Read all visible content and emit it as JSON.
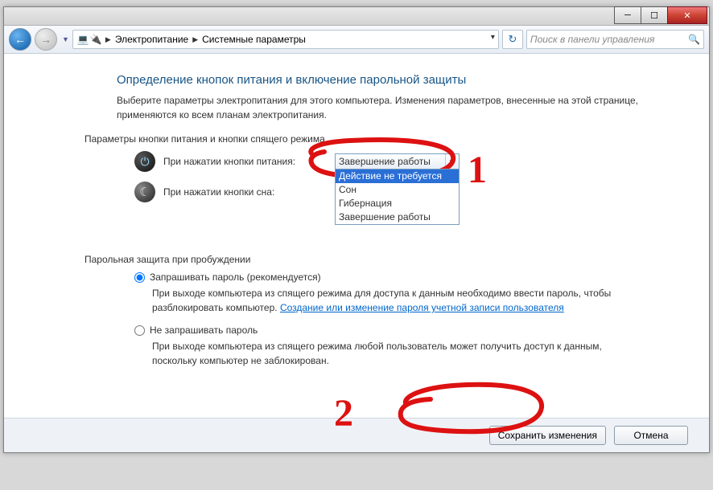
{
  "breadcrumb": {
    "icon1": "💻",
    "icon2": "🔌",
    "seg1": "Электропитание",
    "seg2": "Системные параметры"
  },
  "search": {
    "placeholder": "Поиск в панели управления"
  },
  "heading": "Определение кнопок питания и включение парольной защиты",
  "intro": "Выберите параметры электропитания для этого компьютера. Изменения параметров, внесенные на этой странице, применяются ко всем планам электропитания.",
  "section_buttons": "Параметры кнопки питания и кнопки спящего режима",
  "power": {
    "label": "При нажатии кнопки питания:",
    "selected": "Завершение работы",
    "options": [
      "Действие не требуется",
      "Сон",
      "Гибернация",
      "Завершение работы"
    ]
  },
  "sleep": {
    "label": "При нажатии кнопки сна:"
  },
  "section_password": "Парольная защита при пробуждении",
  "radio1": {
    "label": "Запрашивать пароль (рекомендуется)",
    "desc_a": "При выходе компьютера из спящего режима для доступа к данным необходимо ввести пароль, чтобы разблокировать компьютер. ",
    "link": "Создание или изменение пароля учетной записи пользователя"
  },
  "radio2": {
    "label": "Не запрашивать пароль",
    "desc": "При выходе компьютера из спящего режима любой пользователь может получить доступ к данным, поскольку компьютер не заблокирован."
  },
  "buttons": {
    "save": "Сохранить изменения",
    "cancel": "Отмена"
  },
  "anno": {
    "one": "1",
    "two": "2"
  },
  "win": {
    "min": "─",
    "max": "☐",
    "close": "✕"
  }
}
